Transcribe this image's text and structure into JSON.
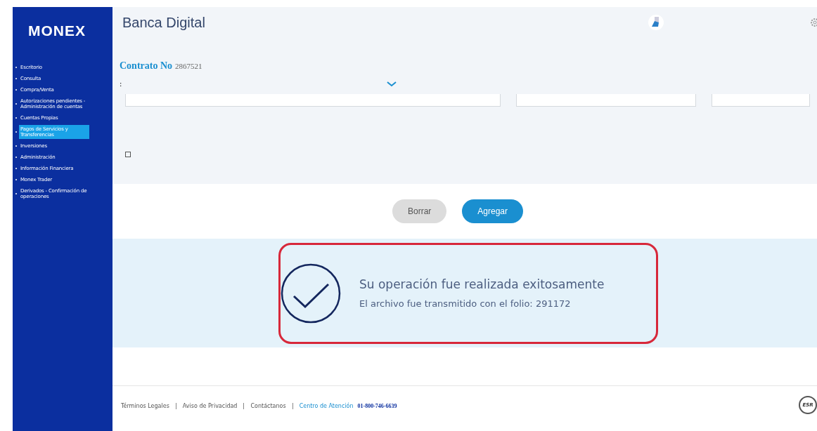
{
  "sidebar": {
    "logo": "MONEX",
    "items": [
      {
        "label": "Escritorio",
        "selected": false
      },
      {
        "label": "Consulta",
        "selected": false
      },
      {
        "label": "Compra/Venta",
        "selected": false
      },
      {
        "label": "Autorizaciones pendientes - Administración de cuentas",
        "selected": false
      },
      {
        "label": "Cuentas Propias",
        "selected": false
      },
      {
        "label": "Pagos de Servicios y Transferencias",
        "selected": true
      },
      {
        "label": "Inversiones",
        "selected": false
      },
      {
        "label": "Administración",
        "selected": false
      },
      {
        "label": "Información Financiera",
        "selected": false
      },
      {
        "label": "Monex Trader",
        "selected": false
      },
      {
        "label": "Derivados - Confirmación de operaciones",
        "selected": false
      }
    ]
  },
  "header": {
    "title": "Banca Digital"
  },
  "contract": {
    "label": "Contrato No",
    "number": "2867521",
    "fragment": ":"
  },
  "form": {
    "checkbox": {
      "checked": false
    },
    "buttons": [
      {
        "label": "Borrar",
        "kind": "secondary"
      },
      {
        "label": "Agregar",
        "kind": "primary"
      }
    ]
  },
  "message": {
    "title": "Su operación fue realizada exitosamente",
    "detail": "El archivo fue transmitido con el folio: 291172"
  },
  "footer": {
    "links": [
      {
        "label": "Términos Legales"
      },
      {
        "label": "Aviso de Privacidad"
      },
      {
        "label": "Contáctanos"
      }
    ],
    "support_label": "Centro de Atención",
    "support_phone": "01-800-746-6639",
    "seal": "ESR"
  }
}
